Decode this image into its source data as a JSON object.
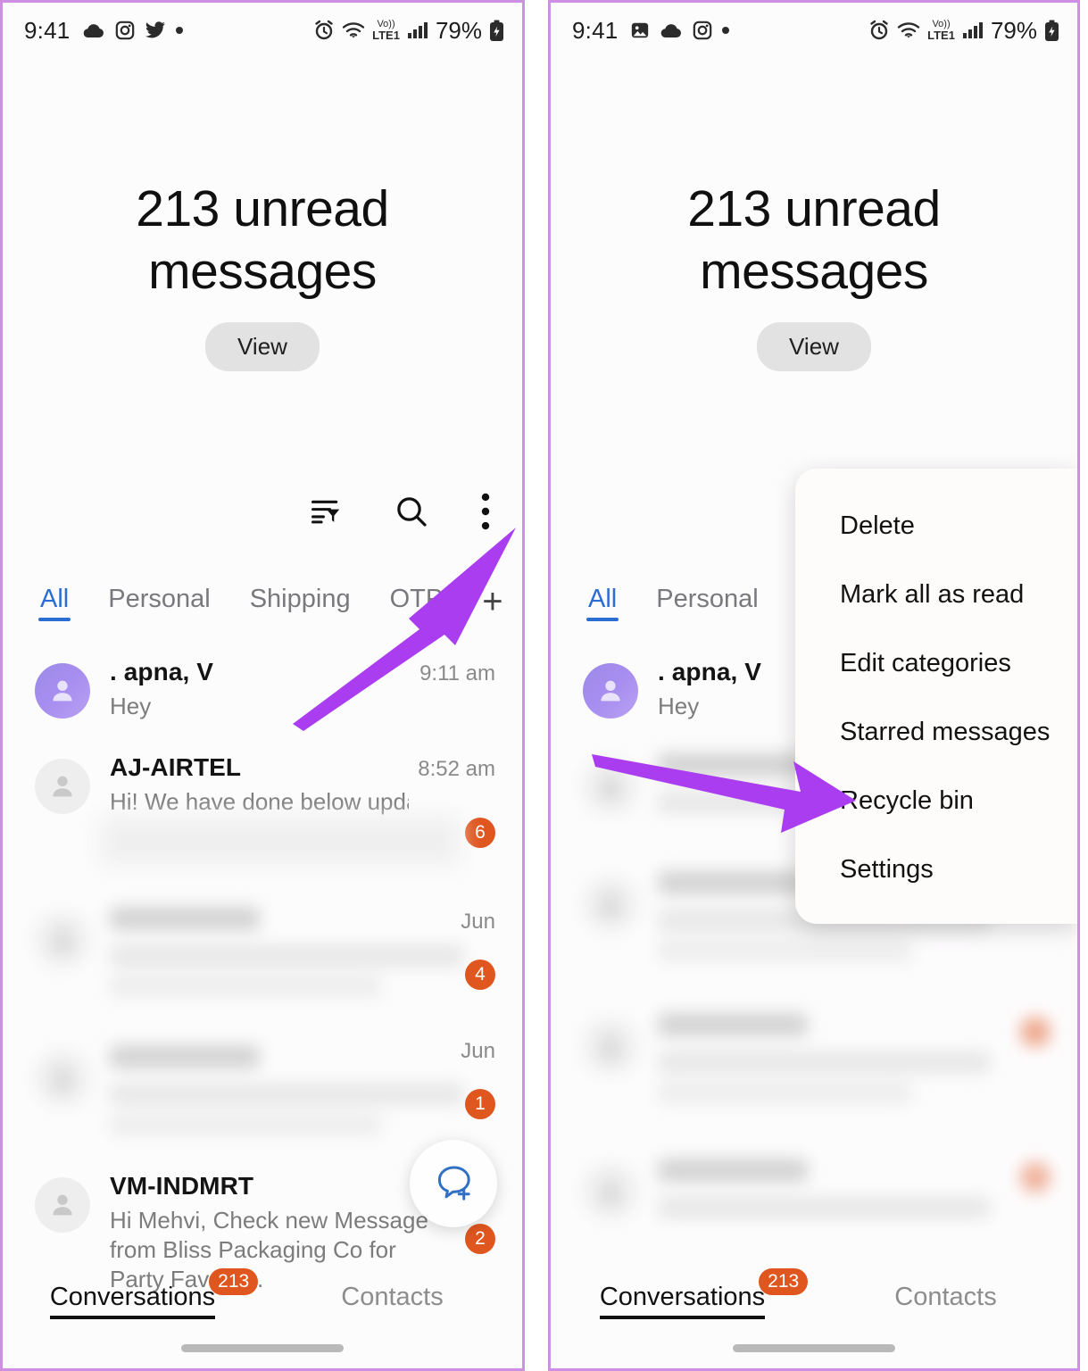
{
  "status_bar": {
    "time": "9:41",
    "battery_percent": "79%",
    "network_label": "LTE1",
    "volte_label": "Vo))",
    "left_icons_left_panel": [
      "weather-cloud-icon",
      "instagram-icon",
      "twitter-icon",
      "more-dot-icon"
    ],
    "left_icons_right_panel": [
      "photos-icon",
      "weather-cloud-icon",
      "instagram-icon",
      "more-dot-icon"
    ],
    "right_icons": [
      "alarm-icon",
      "wifi-icon",
      "volte-icon",
      "signal-icon",
      "battery-icon"
    ]
  },
  "header": {
    "unread_text": "213 unread messages",
    "view_label": "View"
  },
  "toolbar": {
    "sort_icon": "sort-filter-icon",
    "search_icon": "search-icon",
    "more_icon": "more-vertical-icon"
  },
  "tabs": {
    "left": [
      {
        "label": "All",
        "active": true
      },
      {
        "label": "Personal",
        "active": false
      },
      {
        "label": "Shipping",
        "active": false
      },
      {
        "label": "OTP",
        "active": false
      }
    ],
    "right": [
      {
        "label": "All",
        "active": true
      },
      {
        "label": "Personal",
        "active": false
      }
    ],
    "add_label": "+"
  },
  "conversations": [
    {
      "name": ". apna, V",
      "preview": "Hey",
      "time": "9:11 am",
      "badge": "",
      "avatar": "purple",
      "blurred": false
    },
    {
      "name": "AJ-AIRTEL",
      "preview": "Hi! We have done below updation",
      "time": "8:52 am",
      "badge": "6",
      "avatar": "grey",
      "blurred": false
    },
    {
      "name": "",
      "preview": "",
      "time": "Jun",
      "badge": "4",
      "avatar": "grey",
      "blurred": true
    },
    {
      "name": "",
      "preview": "",
      "time": "Jun",
      "badge": "1",
      "avatar": "grey",
      "blurred": true
    },
    {
      "name": "VM-INDMRT",
      "preview": "Hi Mehvi, Check new Message from Bliss Packaging Co for Party Favors…",
      "time": "",
      "badge": "2",
      "avatar": "grey",
      "blurred": false
    }
  ],
  "fab": {
    "icon": "new-conversation-icon"
  },
  "bottom_nav": {
    "conversations_label": "Conversations",
    "conversations_badge": "213",
    "contacts_label": "Contacts"
  },
  "overflow_menu": {
    "items": [
      "Delete",
      "Mark all as read",
      "Edit categories",
      "Starred messages",
      "Recycle bin",
      "Settings"
    ]
  },
  "annotations": {
    "left_arrow_target": "more-vertical-icon",
    "right_arrow_target": "Recycle bin"
  },
  "colors": {
    "accent_blue": "#2a6ed4",
    "badge_orange": "#e0561f",
    "arrow_purple": "#aa3df0",
    "frame_purple": "#cf8fe4",
    "avatar_purple": "#a78ef0",
    "fab_blue": "#2f6fc4"
  }
}
